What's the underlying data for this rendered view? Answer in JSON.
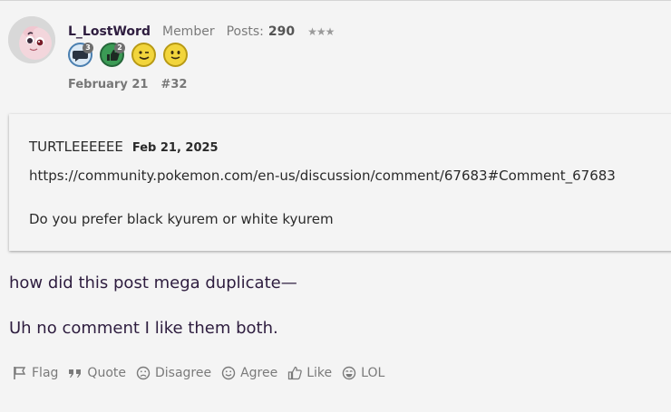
{
  "author": {
    "name": "L_LostWord",
    "role": "Member",
    "posts_label": "Posts:",
    "posts_count": "290",
    "stars": "★★★"
  },
  "badges": [
    {
      "icon": "comment-badge-icon",
      "count": "3",
      "color": "#7fb6e0"
    },
    {
      "icon": "thumbs-up-badge-icon",
      "count": "2",
      "color": "#2f8a4a"
    },
    {
      "icon": "wink-emoji-icon",
      "count": "",
      "color": "#f2d53c"
    },
    {
      "icon": "smile-emoji-icon",
      "count": "",
      "color": "#f2d53c"
    }
  ],
  "meta": {
    "date": "February 21",
    "permalink": "#32"
  },
  "quote": {
    "author": "TURTLEEEEEE",
    "date": "Feb 21, 2025",
    "link": "https://community.pokemon.com/en-us/discussion/comment/67683#Comment_67683",
    "text": "Do you prefer black kyurem or white kyurem"
  },
  "body": {
    "line1": "how did this post mega duplicate—",
    "line2": "Uh no comment I like them both."
  },
  "reactions": {
    "flag": "Flag",
    "quote": "Quote",
    "disagree": "Disagree",
    "agree": "Agree",
    "like": "Like",
    "lol": "LOL"
  }
}
